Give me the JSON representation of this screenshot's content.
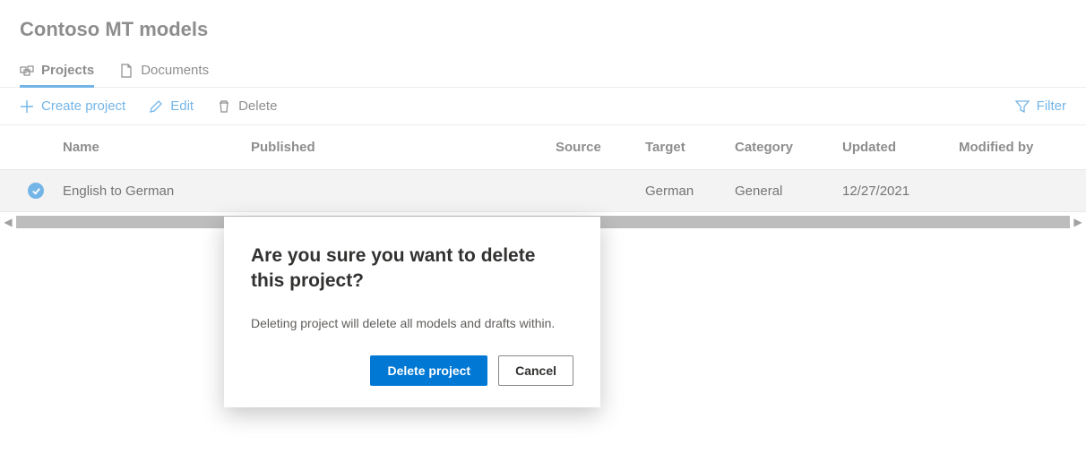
{
  "title": "Contoso MT models",
  "tabs": {
    "projects": "Projects",
    "documents": "Documents"
  },
  "commands": {
    "create": "Create project",
    "edit": "Edit",
    "delete": "Delete",
    "filter": "Filter"
  },
  "grid": {
    "headers": {
      "name": "Name",
      "published": "Published",
      "source": "Source",
      "target": "Target",
      "category": "Category",
      "updated": "Updated",
      "modified_by": "Modified by"
    },
    "row": {
      "name": "English to German",
      "published": "",
      "source": "",
      "target": "German",
      "category": "General",
      "updated": "12/27/2021",
      "modified_by": ""
    }
  },
  "dialog": {
    "title": "Are you sure you want to delete this project?",
    "message": "Deleting project will delete all models and drafts within.",
    "delete": "Delete project",
    "cancel": "Cancel"
  }
}
